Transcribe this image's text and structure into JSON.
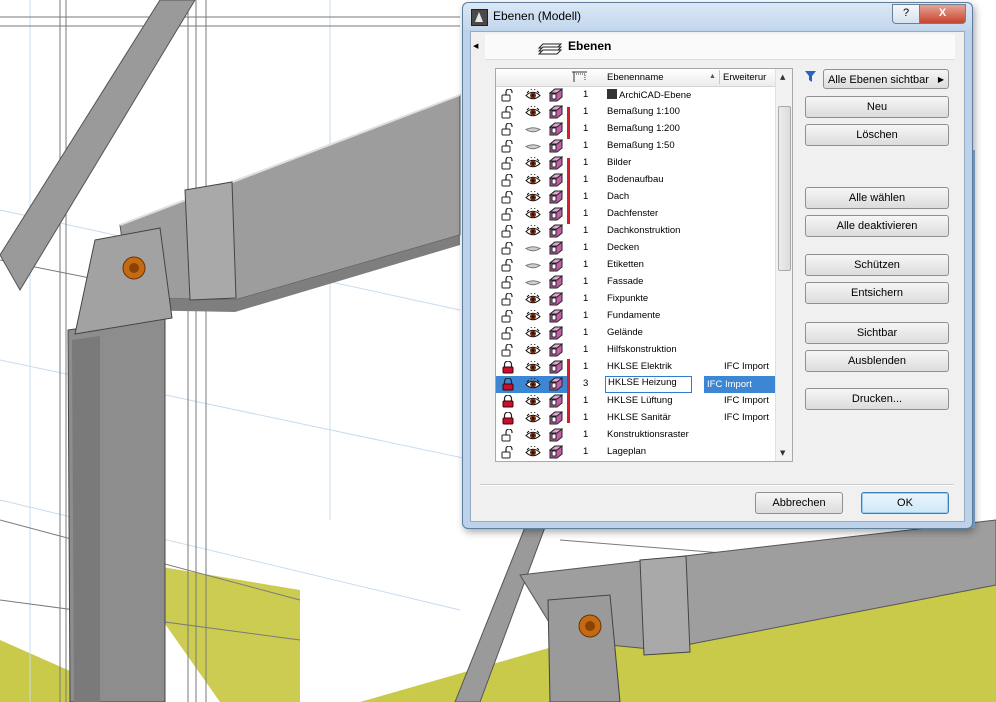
{
  "window": {
    "title": "Ebenen (Modell)",
    "help_label": "?",
    "close_label": "X"
  },
  "panel": {
    "collapse_glyph": "◀",
    "title": "Ebenen"
  },
  "list": {
    "columns": {
      "name": "Ebenenname",
      "extension": "Erweiterur",
      "sort_glyph": "▲"
    },
    "rows": [
      {
        "num": "1",
        "name": "ArchiCAD-Ebene",
        "ext": "",
        "lock": "open",
        "eye": "shown",
        "special": true
      },
      {
        "num": "1",
        "name": "Bemaßung 1:100",
        "ext": "",
        "lock": "open",
        "eye": "shown"
      },
      {
        "num": "1",
        "name": "Bemaßung 1:200",
        "ext": "",
        "lock": "open",
        "eye": "hidden"
      },
      {
        "num": "1",
        "name": "Bemaßung 1:50",
        "ext": "",
        "lock": "open",
        "eye": "hidden"
      },
      {
        "num": "1",
        "name": "Bilder",
        "ext": "",
        "lock": "open",
        "eye": "shown"
      },
      {
        "num": "1",
        "name": "Bodenaufbau",
        "ext": "",
        "lock": "open",
        "eye": "shown"
      },
      {
        "num": "1",
        "name": "Dach",
        "ext": "",
        "lock": "open",
        "eye": "shown"
      },
      {
        "num": "1",
        "name": "Dachfenster",
        "ext": "",
        "lock": "open",
        "eye": "shown"
      },
      {
        "num": "1",
        "name": "Dachkonstruktion",
        "ext": "",
        "lock": "open",
        "eye": "shown"
      },
      {
        "num": "1",
        "name": "Decken",
        "ext": "",
        "lock": "open",
        "eye": "hidden"
      },
      {
        "num": "1",
        "name": "Etiketten",
        "ext": "",
        "lock": "open",
        "eye": "hidden"
      },
      {
        "num": "1",
        "name": "Fassade",
        "ext": "",
        "lock": "open",
        "eye": "hidden"
      },
      {
        "num": "1",
        "name": "Fixpunkte",
        "ext": "",
        "lock": "open",
        "eye": "shown"
      },
      {
        "num": "1",
        "name": "Fundamente",
        "ext": "",
        "lock": "open",
        "eye": "shown"
      },
      {
        "num": "1",
        "name": "Gelände",
        "ext": "",
        "lock": "open",
        "eye": "shown"
      },
      {
        "num": "1",
        "name": "Hilfskonstruktion",
        "ext": "",
        "lock": "open",
        "eye": "shown"
      },
      {
        "num": "1",
        "name": "HKLSE Elektrik",
        "ext": "IFC Import",
        "lock": "locked",
        "eye": "shown"
      },
      {
        "num": "3",
        "name": "HKLSE Heizung",
        "ext": "IFC Import",
        "lock": "locked",
        "eye": "shown",
        "selected": true
      },
      {
        "num": "1",
        "name": "HKLSE Lüftung",
        "ext": "IFC Import",
        "lock": "locked",
        "eye": "shown"
      },
      {
        "num": "1",
        "name": "HKLSE Sanitär",
        "ext": "IFC Import",
        "lock": "locked",
        "eye": "shown"
      },
      {
        "num": "1",
        "name": "Konstruktionsraster",
        "ext": "",
        "lock": "open",
        "eye": "shown"
      },
      {
        "num": "1",
        "name": "Lageplan",
        "ext": "",
        "lock": "open",
        "eye": "shown"
      }
    ]
  },
  "buttons": {
    "visibility_filter": "Alle Ebenen sichtbar",
    "new": "Neu",
    "delete": "Löschen",
    "select_all": "Alle wählen",
    "deselect_all": "Alle deaktivieren",
    "protect": "Schützen",
    "unprotect": "Entsichern",
    "show": "Sichtbar",
    "hide": "Ausblenden",
    "print": "Drucken...",
    "cancel": "Abbrechen",
    "ok": "OK"
  },
  "colors": {
    "selection": "#3d86d3",
    "ground": "#c9c94a",
    "steel": "#9d9d9d",
    "red_marker": "#d21f2d",
    "lock_red": "#c8102e"
  }
}
